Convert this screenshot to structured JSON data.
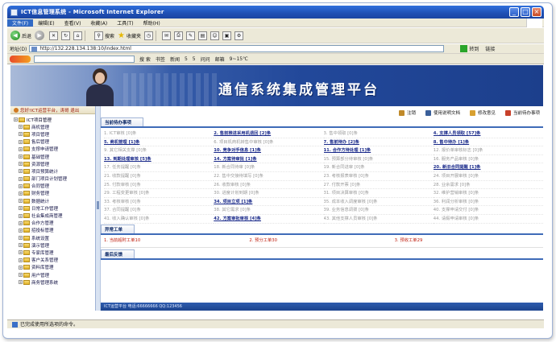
{
  "window": {
    "title": "ICT信息管理系统 - Microsoft Internet Explorer",
    "min": "_",
    "max": "□",
    "close": "×"
  },
  "menu": [
    "文件(F)",
    "编辑(E)",
    "查看(V)",
    "收藏(A)",
    "工具(T)",
    "帮助(H)"
  ],
  "toolbar": {
    "back": "后退",
    "search": "搜索",
    "favorites": "收藏夹"
  },
  "address": {
    "label": "地址(D)",
    "url": "http://132.228.134.138:10/index.html",
    "go": "转到",
    "links": "链接"
  },
  "toolbar2": {
    "search_btn": "搜 索",
    "bookmarks": "书签",
    "news": "新闻",
    "item3": "5",
    "item4": "5",
    "item5": "问问",
    "mail": "邮箱",
    "weather": "9~15℃"
  },
  "banner": {
    "title": "通信系统集成管理平台"
  },
  "sidebar": {
    "user": "您好!ICT运营平台，涛哥 退出",
    "items": [
      {
        "label": "ICT项目管理",
        "root": true
      },
      {
        "label": "商机管理"
      },
      {
        "label": "项目管理"
      },
      {
        "label": "售后管理"
      },
      {
        "label": "支撑申请管理"
      },
      {
        "label": "基础管理"
      },
      {
        "label": "资源管理"
      },
      {
        "label": "项目预算统计"
      },
      {
        "label": "部门项目计划管理"
      },
      {
        "label": "合同管理"
      },
      {
        "label": "财务管理"
      },
      {
        "label": "数据统计"
      },
      {
        "label": "日常工作管理"
      },
      {
        "label": "社会集成商管理"
      },
      {
        "label": "合作方管理"
      },
      {
        "label": "招投标管理"
      },
      {
        "label": "系统设置"
      },
      {
        "label": "演示管理"
      },
      {
        "label": "专家库管理"
      },
      {
        "label": "客户关系管理"
      },
      {
        "label": "资料库管理"
      },
      {
        "label": "用户管理"
      },
      {
        "label": "商务管理系统"
      }
    ]
  },
  "topnav": {
    "logout": "注销",
    "help": "使用说明文档",
    "feedback": "修改意见",
    "today": "当前待办事项"
  },
  "sections": {
    "todo": "当前待办事项",
    "work": "异常工单",
    "feedback": "最后反馈"
  },
  "todo": [
    {
      "text": "1. ICT审核 [0]条",
      "hot": false
    },
    {
      "text": "2. 售前推进采用机退回 [2]条",
      "hot": true
    },
    {
      "text": "3. 售中领取 [0]条",
      "hot": false
    },
    {
      "text": "4. 支撑人员领取 [57]条",
      "hot": true
    },
    {
      "text": "5. 商机管理 [1]条",
      "hot": true
    },
    {
      "text": "6. 项目机商机转售中审核 [0]条",
      "hot": false
    },
    {
      "text": "7. 售前待办 [2]条",
      "hot": true
    },
    {
      "text": "8. 售中待办 [1]条",
      "hot": true
    },
    {
      "text": "9. 其它相关支撑 [0]条",
      "hot": false
    },
    {
      "text": "10. 竞争对手信息 [1]条",
      "hot": true
    },
    {
      "text": "11. 合作方待处理 [1]条",
      "hot": true
    },
    {
      "text": "12. 报价单审核标志 [0]条",
      "hot": false
    },
    {
      "text": "13. 到期处理审核 [5]条",
      "hot": true
    },
    {
      "text": "14. 方案待审批 [1]条",
      "hot": true
    },
    {
      "text": "15. 预算部分待审核 [0]条",
      "hot": false
    },
    {
      "text": "16. 服务产品审核 [0]条",
      "hot": false
    },
    {
      "text": "17. 任务提醒 [0]条",
      "hot": false
    },
    {
      "text": "18. 新合同待审 [0]条",
      "hot": false
    },
    {
      "text": "19. 新合同进审 [0]条",
      "hot": false
    },
    {
      "text": "20. 新旧合同提醒 [1]条",
      "hot": true
    },
    {
      "text": "21. 收款提醒 [0]条",
      "hot": false
    },
    {
      "text": "22. 售中交接待填写 [0]条",
      "hot": false
    },
    {
      "text": "23. 考核报表审核 [0]条",
      "hot": false
    },
    {
      "text": "24. 项目开展审核 [0]条",
      "hot": false
    },
    {
      "text": "25. 付款审核 [0]条",
      "hot": false
    },
    {
      "text": "26. 收款审核 [0]条",
      "hot": false
    },
    {
      "text": "27. 付款开票 [0]条",
      "hot": false
    },
    {
      "text": "28. 业余需求 [0]条",
      "hot": false
    },
    {
      "text": "29. 工程变更审核 [0]条",
      "hot": false
    },
    {
      "text": "30. 进度计划到期 [0]条",
      "hot": false
    },
    {
      "text": "31. 项目决算审核 [0]条",
      "hot": false
    },
    {
      "text": "32. 维护营销审核 [0]条",
      "hot": false
    },
    {
      "text": "33. 考核审核 [0]条",
      "hot": false
    },
    {
      "text": "34. 项目立项 [1]条",
      "hot": true
    },
    {
      "text": "35. 成本收入调度审核 [0]条",
      "hot": false
    },
    {
      "text": "36. 利润分析审核 [0]条",
      "hot": false
    },
    {
      "text": "37. 合同提醒 [0]条",
      "hot": false
    },
    {
      "text": "38. 其它需求 [0]条",
      "hot": false
    },
    {
      "text": "39. 业务信息调拨 [0]条",
      "hot": false
    },
    {
      "text": "40. 支撑申请交付 [0]条",
      "hot": false
    },
    {
      "text": "41. 收入确认审核 [0]条",
      "hot": false
    },
    {
      "text": "42. 方案审批审核 [4]条",
      "hot": true
    },
    {
      "text": "43. 其他支撑人员审核 [0]条",
      "hot": false
    },
    {
      "text": "44. 请假申请审核 [0]条",
      "hot": false
    }
  ],
  "work": [
    "1. 当前超时工单10",
    "2. 预分工单30",
    "3. 预收工单29"
  ],
  "footer_text": "ICT运营平台 电话:66666666 QQ:123456",
  "ie_status": "已完成使用所选项的命令。"
}
